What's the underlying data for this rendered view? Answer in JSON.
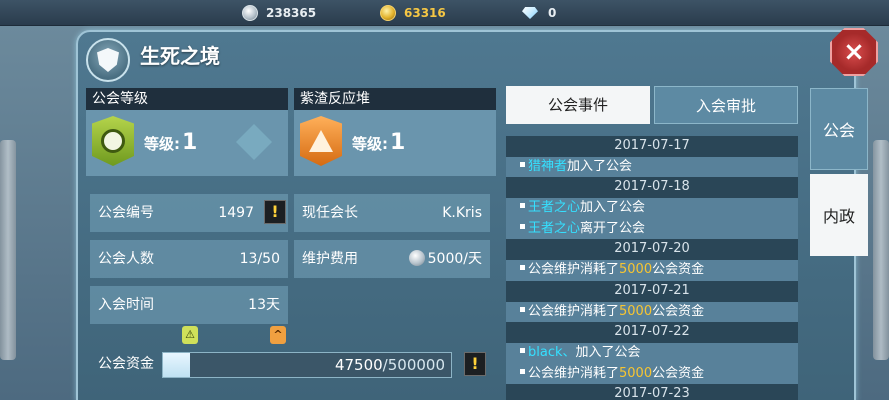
{
  "resources": {
    "silver": "238365",
    "gold": "63316",
    "gems": "0"
  },
  "window": {
    "title": "生死之境"
  },
  "guild_level": {
    "header": "公会等级",
    "label": "等级:",
    "value": "1"
  },
  "reactor_level": {
    "header": "紫渣反应堆",
    "label": "等级:",
    "value": "1"
  },
  "info": {
    "guild_id_label": "公会编号",
    "guild_id": "1497",
    "leader_label": "现任会长",
    "leader": "K.Kris",
    "members_label": "公会人数",
    "members": "13/50",
    "upkeep_label": "维护费用",
    "upkeep": "5000/天",
    "join_time_label": "入会时间",
    "join_time": "13天",
    "funds_label": "公会资金",
    "funds_current": "47500",
    "funds_max": "/500000",
    "funds_fraction": 0.095,
    "warn_glyph": "!"
  },
  "tabs": {
    "events": "公会事件",
    "review": "入会审批"
  },
  "side_tabs": {
    "guild": "公会",
    "internal": "内政"
  },
  "event_log": [
    {
      "type": "date",
      "text": "2017-07-17"
    },
    {
      "type": "event",
      "name": "猎神者",
      "text": "加入了公会"
    },
    {
      "type": "date",
      "text": "2017-07-18"
    },
    {
      "type": "event",
      "name": "王者之心",
      "text": "加入了公会"
    },
    {
      "type": "event",
      "name": "王者之心",
      "text": "离开了公会"
    },
    {
      "type": "date",
      "text": "2017-07-20"
    },
    {
      "type": "event",
      "prefix": "公会维护消耗了",
      "amount": "5000",
      "suffix": "公会资金"
    },
    {
      "type": "date",
      "text": "2017-07-21"
    },
    {
      "type": "event",
      "prefix": "公会维护消耗了",
      "amount": "5000",
      "suffix": "公会资金"
    },
    {
      "type": "date",
      "text": "2017-07-22"
    },
    {
      "type": "event",
      "name": "black、",
      "text": "加入了公会"
    },
    {
      "type": "event",
      "prefix": "公会维护消耗了",
      "amount": "5000",
      "suffix": "公会资金"
    },
    {
      "type": "date",
      "text": "2017-07-23"
    }
  ],
  "colors": {
    "name_highlight": "#35e0ff",
    "amount_highlight": "#f7c531",
    "gold_text": "#f6c744",
    "panel_header": "#1f2f3d"
  },
  "icons": {
    "silver": "silver-coin-icon",
    "gold": "gold-coin-icon",
    "gem": "diamond-icon",
    "close": "close-icon",
    "guild_emblem": "shield-icon",
    "guild_badge": "smiley-badge-icon",
    "reactor_badge": "triforce-badge-icon",
    "upgrade": "chevron-up-icon"
  }
}
